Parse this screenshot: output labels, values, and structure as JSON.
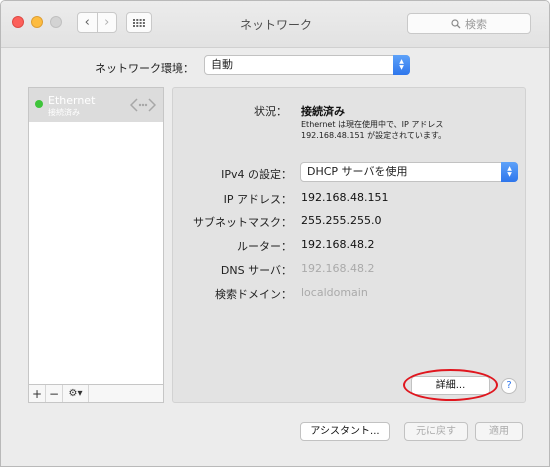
{
  "window": {
    "title": "ネットワーク"
  },
  "toolbar": {
    "search_placeholder": "検索"
  },
  "location": {
    "label": "ネットワーク環境：",
    "value": "自動"
  },
  "sidebar": {
    "services": [
      {
        "name": "Ethernet",
        "status": "接続済み",
        "status_color": "#3ec43a"
      }
    ],
    "tools": {
      "add": "+",
      "remove": "−",
      "gear": "⚙︎▾"
    }
  },
  "detail": {
    "status_label": "状況：",
    "status_value": "接続済み",
    "status_note_1": "Ethernet は現在使用中で、IP アドレス",
    "status_note_2": "192.168.48.151 が設定されています。",
    "ipv4_label": "IPv4 の設定：",
    "ipv4_value": "DHCP サーバを使用",
    "ip_label": "IP アドレス：",
    "ip_value": "192.168.48.151",
    "subnet_label": "サブネットマスク：",
    "subnet_value": "255.255.255.0",
    "router_label": "ルーター：",
    "router_value": "192.168.48.2",
    "dns_label": "DNS サーバ：",
    "dns_value": "192.168.48.2",
    "search_domain_label": "検索ドメイン：",
    "search_domain_value": "localdomain",
    "advanced_label": "詳細...",
    "help_label": "?"
  },
  "footer": {
    "assistant_label": "アシスタント...",
    "revert_label": "元に戻す",
    "apply_label": "適用"
  }
}
